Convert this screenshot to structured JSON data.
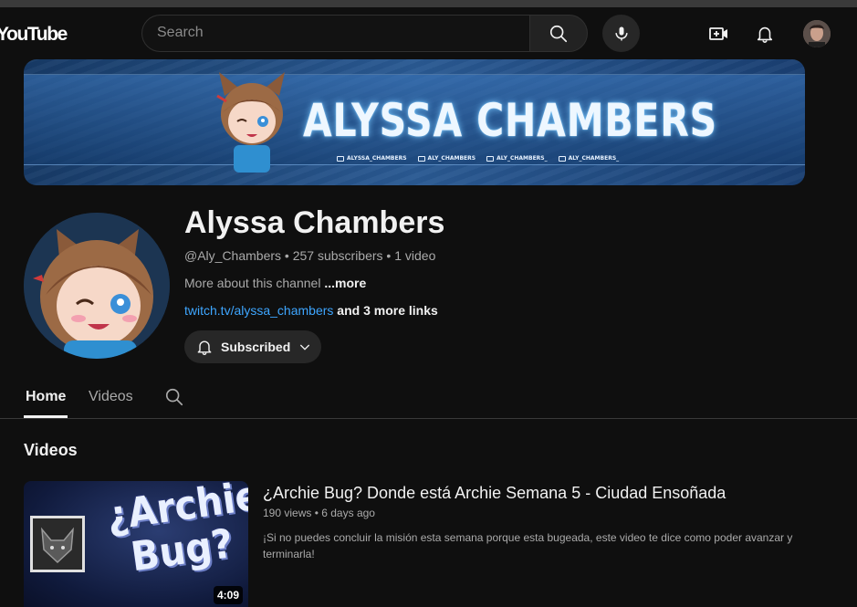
{
  "header": {
    "logo_text": "YouTube",
    "search_placeholder": "Search"
  },
  "banner": {
    "title": "ALYSSA CHAMBERS",
    "handles": [
      "ALYSSA_CHAMBERS",
      "ALY_CHAMBERS",
      "ALY_CHAMBERS_",
      "ALY_CHAMBERS_"
    ]
  },
  "channel": {
    "name": "Alyssa Chambers",
    "handle": "@Aly_Chambers",
    "subscribers": "257 subscribers",
    "video_count": "1 video",
    "about_text": "More about this channel",
    "about_more": "...more",
    "link": "twitch.tv/alyssa_chambers",
    "more_links": "and 3 more links",
    "subscribe_label": "Subscribed"
  },
  "tabs": [
    {
      "label": "Home",
      "active": true
    },
    {
      "label": "Videos",
      "active": false
    }
  ],
  "section": {
    "title": "Videos"
  },
  "video": {
    "title": "¿Archie Bug? Donde está Archie Semana 5 - Ciudad Ensoñada",
    "views": "190 views",
    "age": "6 days ago",
    "description": "¡Si no puedes concluir la misión esta semana porque esta bugeada, este video te dice como poder avanzar y terminarla!",
    "duration": "4:09",
    "thumb_text_line1": "¿Archie",
    "thumb_text_line2": "Bug?"
  },
  "colors": {
    "background": "#0f0f0f",
    "link": "#3ea6ff",
    "secondary_text": "#aaaaaa"
  }
}
